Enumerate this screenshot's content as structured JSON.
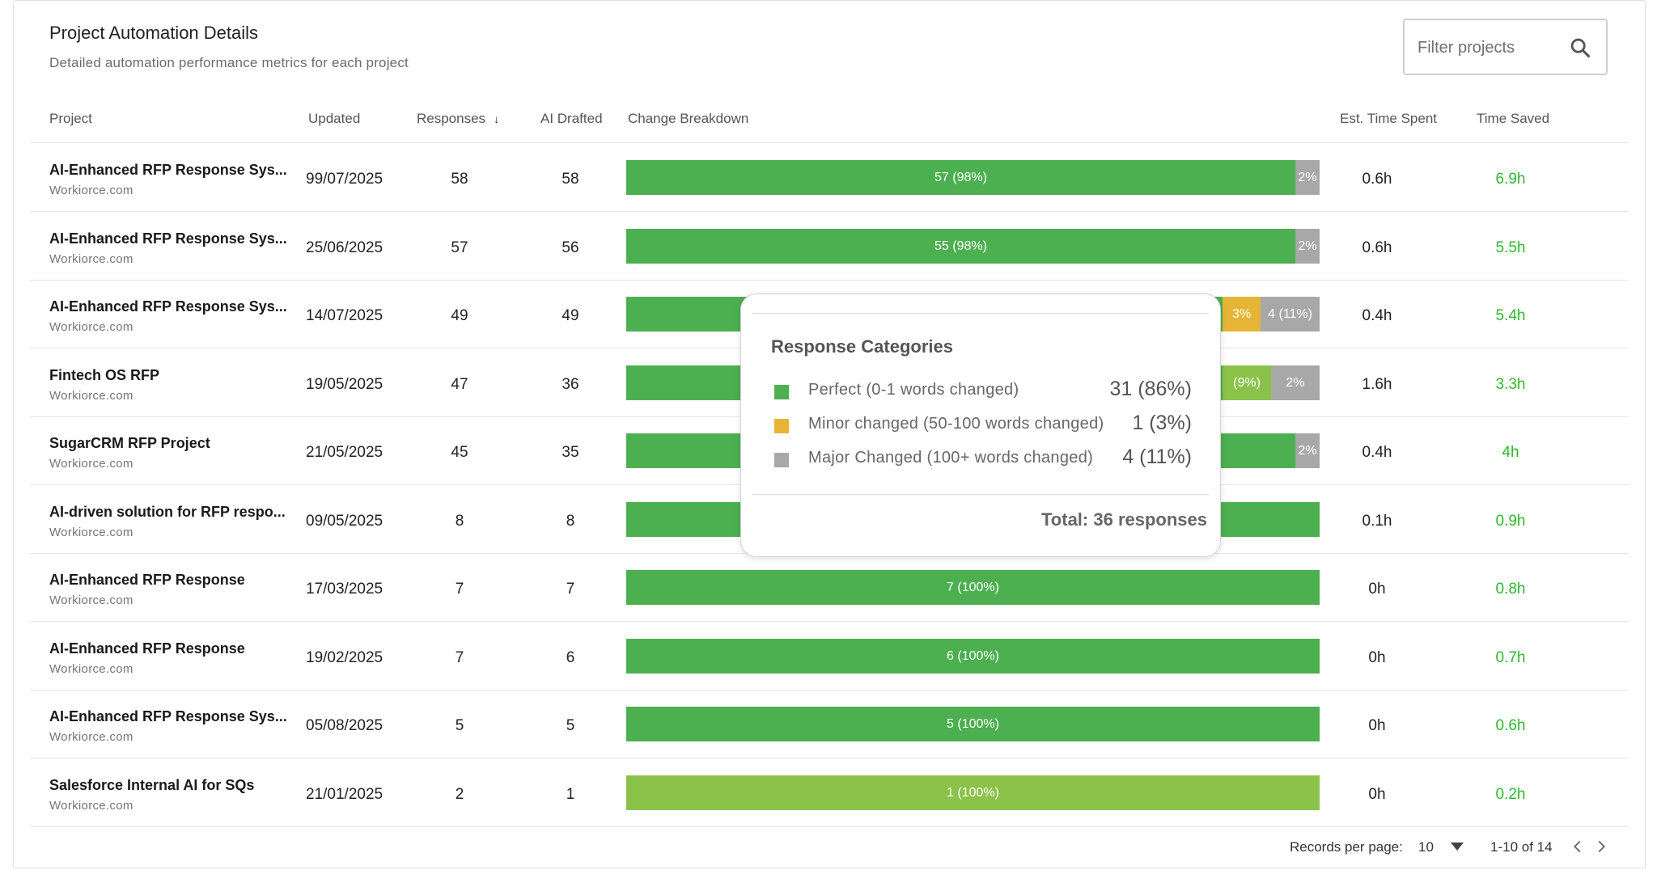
{
  "header": {
    "title": "Project Automation Details",
    "subtitle": "Detailed automation performance metrics for each project"
  },
  "search": {
    "placeholder": "Filter projects",
    "icon": "search-icon"
  },
  "columns": {
    "project": "Project",
    "updated": "Updated",
    "responses": "Responses",
    "ai_drafted": "AI Drafted",
    "change_breakdown": "Change Breakdown",
    "est_time": "Est. Time Spent",
    "time_saved": "Time Saved",
    "sort_indicator": "↓"
  },
  "colors": {
    "perfect": "#4caf50",
    "perfect_light": "#8bc34a",
    "minor": "#e6b535",
    "major": "#a8a8a8",
    "saved_text": "#2eb82e"
  },
  "rows": [
    {
      "name": "AI-Enhanced RFP Response Sys...",
      "domain": "Workiorce.com",
      "updated": "99/07/2025",
      "responses": "58",
      "ai_drafted": "58",
      "est_time": "0.6h",
      "time_saved": "6.9h",
      "segments": [
        {
          "pct": 96.5,
          "color": "green",
          "label": "57 (98%)"
        },
        {
          "pct": 3.5,
          "color": "grey",
          "label": "2%"
        }
      ]
    },
    {
      "name": "AI-Enhanced RFP Response Sys...",
      "domain": "Workiorce.com",
      "updated": "25/06/2025",
      "responses": "57",
      "ai_drafted": "56",
      "est_time": "0.6h",
      "time_saved": "5.5h",
      "segments": [
        {
          "pct": 96.5,
          "color": "green",
          "label": "55 (98%)"
        },
        {
          "pct": 3.5,
          "color": "grey",
          "label": "2%"
        }
      ]
    },
    {
      "name": "AI-Enhanced RFP Response Sys...",
      "domain": "Workiorce.com",
      "updated": "14/07/2025",
      "responses": "49",
      "ai_drafted": "49",
      "est_time": "0.4h",
      "time_saved": "5.4h",
      "segments": [
        {
          "pct": 86,
          "color": "green",
          "label": ""
        },
        {
          "pct": 5.5,
          "color": "yellow",
          "label": "3%"
        },
        {
          "pct": 8.5,
          "color": "grey",
          "label": "4 (11%)"
        }
      ]
    },
    {
      "name": "Fintech OS RFP",
      "domain": "Workiorce.com",
      "updated": "19/05/2025",
      "responses": "47",
      "ai_drafted": "36",
      "est_time": "1.6h",
      "time_saved": "3.3h",
      "segments": [
        {
          "pct": 86,
          "color": "green",
          "label": ""
        },
        {
          "pct": 7,
          "color": "lime",
          "label": "(9%)"
        },
        {
          "pct": 7,
          "color": "grey",
          "label": "2%"
        }
      ]
    },
    {
      "name": "SugarCRM RFP Project",
      "domain": "Workiorce.com",
      "updated": "21/05/2025",
      "responses": "45",
      "ai_drafted": "35",
      "est_time": "0.4h",
      "time_saved": "4h",
      "segments": [
        {
          "pct": 96.5,
          "color": "green",
          "label": ""
        },
        {
          "pct": 3.5,
          "color": "grey",
          "label": "2%"
        }
      ]
    },
    {
      "name": "AI-driven solution for RFP respo...",
      "domain": "Workiorce.com",
      "updated": "09/05/2025",
      "responses": "8",
      "ai_drafted": "8",
      "est_time": "0.1h",
      "time_saved": "0.9h",
      "segments": [
        {
          "pct": 100,
          "color": "green",
          "label": ""
        }
      ]
    },
    {
      "name": "AI-Enhanced RFP Response",
      "domain": "Workiorce.com",
      "updated": "17/03/2025",
      "responses": "7",
      "ai_drafted": "7",
      "est_time": "0h",
      "time_saved": "0.8h",
      "segments": [
        {
          "pct": 100,
          "color": "green",
          "label": "7 (100%)"
        }
      ]
    },
    {
      "name": "AI-Enhanced RFP Response",
      "domain": "Workiorce.com",
      "updated": "19/02/2025",
      "responses": "7",
      "ai_drafted": "6",
      "est_time": "0h",
      "time_saved": "0.7h",
      "segments": [
        {
          "pct": 100,
          "color": "green",
          "label": "6 (100%)"
        }
      ]
    },
    {
      "name": "AI-Enhanced RFP Response Sys...",
      "domain": "Workiorce.com",
      "updated": "05/08/2025",
      "responses": "5",
      "ai_drafted": "5",
      "est_time": "0h",
      "time_saved": "0.6h",
      "segments": [
        {
          "pct": 100,
          "color": "green",
          "label": "5 (100%)"
        }
      ]
    },
    {
      "name": "Salesforce Internal AI for SQs",
      "domain": "Workiorce.com",
      "updated": "21/01/2025",
      "responses": "2",
      "ai_drafted": "1",
      "est_time": "0h",
      "time_saved": "0.2h",
      "segments": [
        {
          "pct": 100,
          "color": "lime",
          "label": "1 (100%)"
        }
      ]
    }
  ],
  "tooltip": {
    "title": "Response Categories",
    "items": [
      {
        "color": "#4caf50",
        "label": "Perfect (0-1 words changed)",
        "value": "31 (86%)"
      },
      {
        "color": "#e6b535",
        "label": "Minor changed (50-100 words changed)",
        "value": "1 (3%)"
      },
      {
        "color": "#a8a8a8",
        "label": "Major Changed (100+ words changed)",
        "value": "4 (11%)"
      }
    ],
    "total": "Total: 36 responses"
  },
  "pagination": {
    "records_label": "Records per page:",
    "per_page": "10",
    "range": "1-10 of 14",
    "prev_icon": "chevron-left-icon",
    "next_icon": "chevron-right-icon"
  }
}
